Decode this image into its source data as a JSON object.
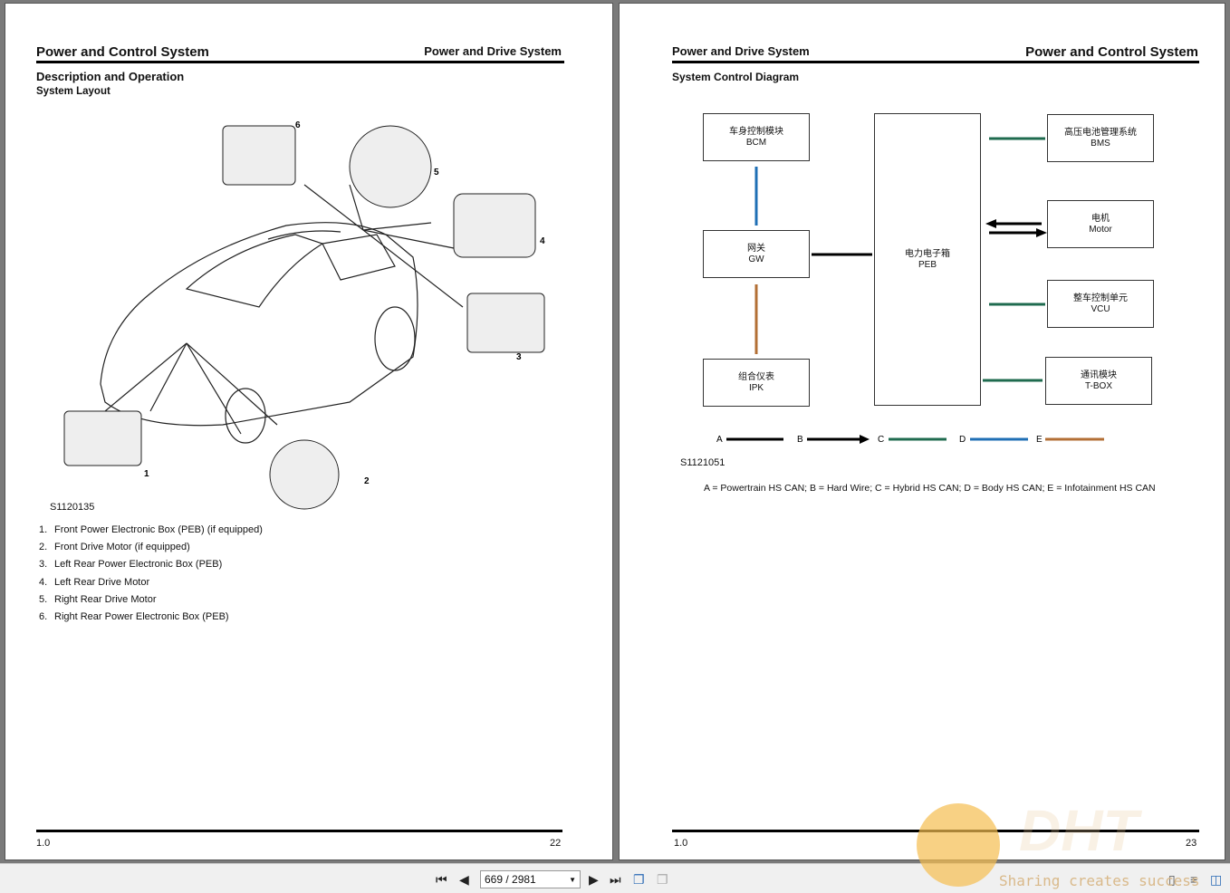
{
  "left_page": {
    "header_left": "Power and Control System",
    "header_right": "Power and Drive System",
    "section_title": "Description and Operation",
    "subsection_title": "System Layout",
    "figure_id": "S1120135",
    "callouts": [
      "1",
      "2",
      "3",
      "4",
      "5",
      "6"
    ],
    "legend": [
      {
        "num": "1.",
        "text": "Front Power Electronic Box (PEB) (if equipped)"
      },
      {
        "num": "2.",
        "text": "Front Drive Motor (if equipped)"
      },
      {
        "num": "3.",
        "text": "Left Rear Power Electronic Box (PEB)"
      },
      {
        "num": "4.",
        "text": "Left Rear Drive Motor"
      },
      {
        "num": "5.",
        "text": "Right Rear Drive Motor"
      },
      {
        "num": "6.",
        "text": "Right Rear Power Electronic Box (PEB)"
      }
    ],
    "footer_version": "1.0",
    "page_number": "22"
  },
  "right_page": {
    "header_left": "Power and Drive System",
    "header_right": "Power and Control System",
    "section_title": "System Control Diagram",
    "modules": {
      "bcm": {
        "cn": "车身控制模块",
        "en": "BCM"
      },
      "gw": {
        "cn": "网关",
        "en": "GW"
      },
      "ipk": {
        "cn": "组合仪表",
        "en": "IPK"
      },
      "peb": {
        "cn": "电力电子箱",
        "en": "PEB"
      },
      "bms": {
        "cn": "高压电池管理系统",
        "en": "BMS"
      },
      "motor": {
        "cn": "电机",
        "en": "Motor"
      },
      "vcu": {
        "cn": "整车控制单元",
        "en": "VCU"
      },
      "tbox": {
        "cn": "通讯模块",
        "en": "T-BOX"
      }
    },
    "line_legend": [
      {
        "key": "A",
        "color": "#000000"
      },
      {
        "key": "B",
        "color": "#000000"
      },
      {
        "key": "C",
        "color": "#1f6b4f"
      },
      {
        "key": "D",
        "color": "#1f6fb5"
      },
      {
        "key": "E",
        "color": "#b36f35"
      }
    ],
    "figure_id": "S1121051",
    "caption": "A = Powertrain HS CAN; B = Hard Wire; C = Hybrid HS CAN; D = Body HS CAN; E = Infotainment HS CAN",
    "footer_version": "1.0",
    "page_number": "23"
  },
  "toolbar": {
    "page_indicator": "669 / 2981",
    "first_icon": "first-page-icon",
    "prev_icon": "prev-page-icon",
    "next_icon": "next-page-icon",
    "last_icon": "last-page-icon"
  },
  "watermark": {
    "logo": "DHT",
    "tagline": "Sharing creates success"
  }
}
